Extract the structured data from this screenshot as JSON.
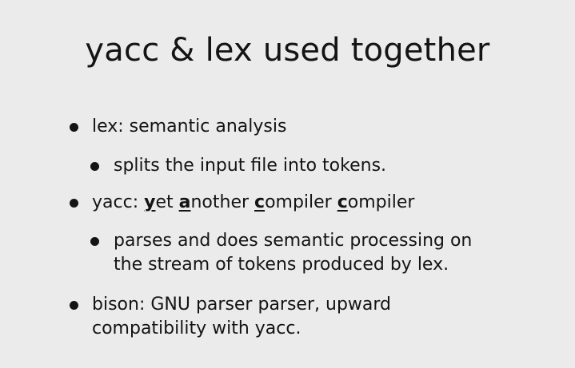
{
  "title": "yacc & lex used together",
  "bullets": {
    "lex": {
      "text": "lex: semantic analysis"
    },
    "lex_sub": {
      "text": "splits the input file into tokens."
    },
    "yacc": {
      "prefix": "yacc: ",
      "y": "y",
      "y_rest": "et ",
      "a": "a",
      "a_rest": "nother ",
      "c1": "c",
      "c1_rest": "ompiler ",
      "c2": "c",
      "c2_rest": "ompiler"
    },
    "yacc_sub": {
      "line1": "parses and does semantic processing on",
      "line2": "the stream of tokens produced by lex."
    },
    "bison": {
      "line1": "bison: GNU parser parser, upward",
      "line2": "compatibility with yacc."
    }
  }
}
